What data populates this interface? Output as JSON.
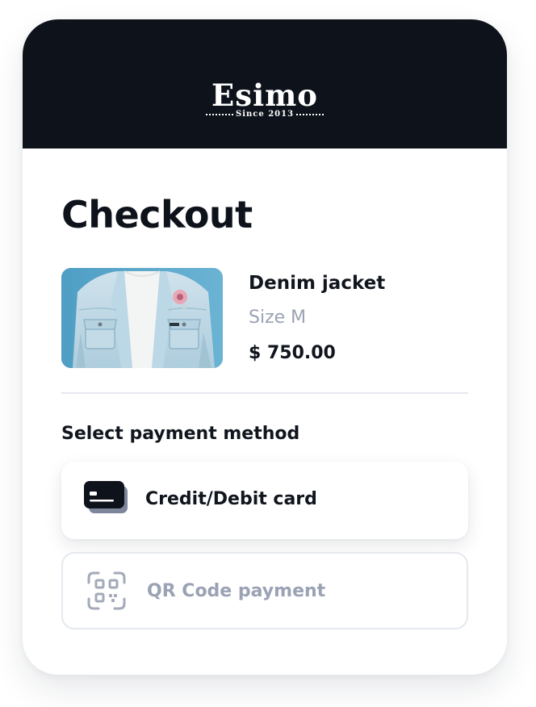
{
  "brand": {
    "name": "Esimo",
    "tagline": "Since 2013"
  },
  "page": {
    "title": "Checkout"
  },
  "product": {
    "name": "Denim jacket",
    "size": "Size M",
    "price": "$ 750.00",
    "image_icon": "denim-jacket-photo"
  },
  "payment": {
    "section_label": "Select payment method",
    "options": [
      {
        "label": "Credit/Debit card",
        "icon": "credit-card-icon",
        "state": "selected"
      },
      {
        "label": "QR Code payment",
        "icon": "qr-code-icon",
        "state": "unselected"
      }
    ]
  },
  "colors": {
    "header_bg": "#0e121b",
    "text_primary": "#11151d",
    "text_muted": "#9aa2b4",
    "border": "#e5e8ee"
  }
}
